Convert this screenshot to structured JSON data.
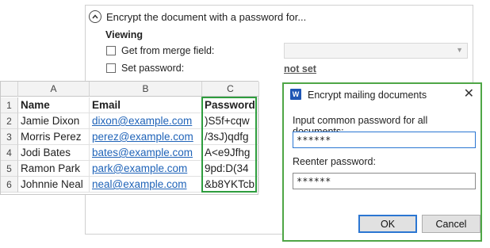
{
  "panel": {
    "title": "Encrypt the document with a password for...",
    "section_label": "Viewing",
    "option_merge_label": "Get from merge field:",
    "option_set_label": "Set password:",
    "merge_field_value": "",
    "not_set_label": "not set",
    "collapse_icon": "chevron-up-icon"
  },
  "sheet": {
    "column_headers": [
      "A",
      "B",
      "C"
    ],
    "row_numbers": [
      "1",
      "2",
      "3",
      "4",
      "5",
      "6"
    ],
    "header_row": [
      "Name",
      "Email",
      "Password"
    ],
    "rows": [
      [
        "Jamie Dixon",
        "dixon@example.com",
        ")S5f+cqw"
      ],
      [
        "Morris Perez",
        "perez@example.com",
        "/3sJ)qdfg"
      ],
      [
        "Jodi Bates",
        "bates@example.com",
        "A<e9Jfhg"
      ],
      [
        "Ramon Park",
        "park@example.com",
        "9pd:D(34"
      ],
      [
        "Johnnie Neal",
        "neal@example.com",
        "&b8YKTcb"
      ]
    ],
    "selection_color": "#2e9d3e",
    "link_color": "#1f63b8"
  },
  "dialog": {
    "title": "Encrypt mailing documents",
    "app_icon": "word-icon",
    "app_icon_letter": "W",
    "close_glyph": "✕",
    "label_password": "Input common password for all documents:",
    "password_value": "******",
    "label_reenter": "Reenter password:",
    "reenter_value": "******",
    "ok_label": "OK",
    "cancel_label": "Cancel",
    "border_color": "#4fa646"
  }
}
